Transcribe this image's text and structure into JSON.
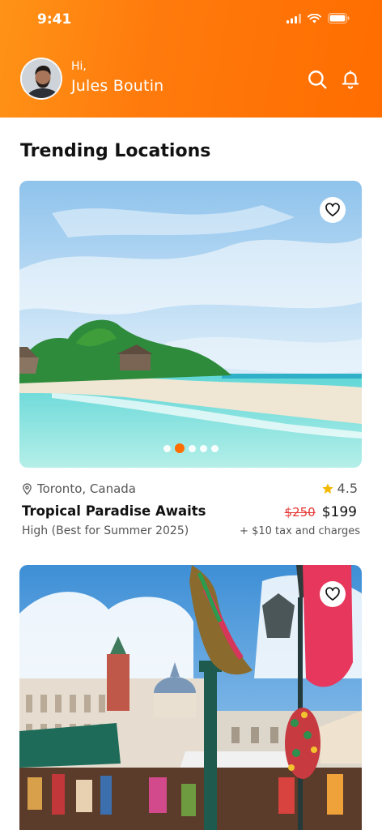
{
  "status_bar": {
    "time": "9:41"
  },
  "header": {
    "greeting": "Hi,",
    "username": "Jules Boutin",
    "icons": [
      "search-icon",
      "bell-icon"
    ]
  },
  "section": {
    "title": "Trending Locations"
  },
  "colors": {
    "accent": "#ff6d00",
    "strike_price": "#e53935",
    "star": "#f5b800"
  },
  "cards": [
    {
      "location": "Toronto, Canada",
      "rating": "4.5",
      "title": "Tropical Paradise Awaits",
      "subtitle": "High (Best for Summer 2025)",
      "old_price": "$250",
      "price": "$199",
      "tax_note": "+ $10 tax and charges",
      "carousel": {
        "count": 5,
        "active": 2
      }
    }
  ]
}
